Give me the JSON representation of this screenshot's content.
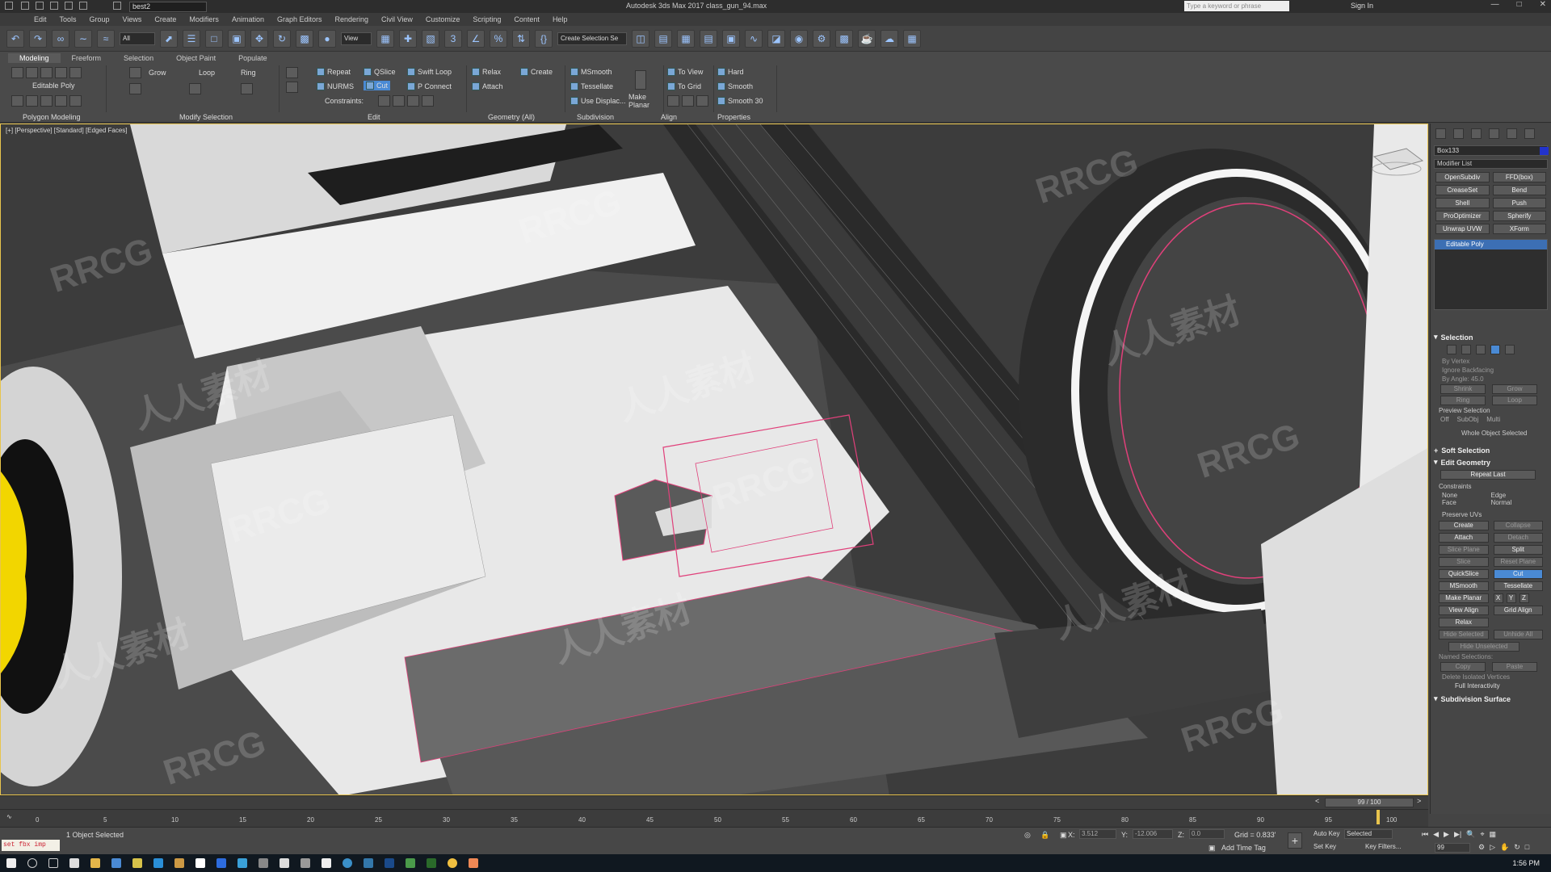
{
  "titlebar": {
    "workspace": "best2",
    "title": "Autodesk 3ds Max 2017     class_gun_94.max",
    "search_placeholder": "Type a keyword or phrase",
    "sign_in": "Sign In"
  },
  "menu": [
    "Edit",
    "Tools",
    "Group",
    "Views",
    "Create",
    "Modifiers",
    "Animation",
    "Graph Editors",
    "Rendering",
    "Civil View",
    "Customize",
    "Scripting",
    "Content",
    "Help"
  ],
  "toolbar": {
    "filter": "All",
    "ref_coord": "View",
    "selection_set": "Create Selection Se"
  },
  "ribbon": {
    "tabs": [
      "Modeling",
      "Freeform",
      "Selection",
      "Object Paint",
      "Populate"
    ],
    "active_tab": "Modeling",
    "polygon_modeling": "Polygon Modeling",
    "editable_poly": "Editable Poly",
    "modify_selection": "Modify Selection",
    "loop": "Loop",
    "ring": "Ring",
    "grow": "Grow",
    "edit_label": "Edit",
    "repeat": "Repeat",
    "qslice": "QSlice",
    "swift_loop": "Swift Loop",
    "nurms": "NURMS",
    "cut": "Cut",
    "p_connect": "P Connect",
    "constraints": "Constraints:",
    "relax": "Relax",
    "create": "Create",
    "attach": "Attach",
    "geometry_all": "Geometry (All)",
    "msmooth": "MSmooth",
    "tessellate": "Tessellate",
    "use_displac": "Use Displac...",
    "subdivision": "Subdivision",
    "make_planar": "Make Planar",
    "to_view": "To View",
    "to_grid": "To Grid",
    "align": "Align",
    "hard": "Hard",
    "smooth": "Smooth",
    "smooth30": "Smooth 30",
    "properties": "Properties"
  },
  "viewport": {
    "label": "[+] [Perspective] [Standard] [Edged Faces]",
    "watermarks": [
      "RRCG",
      "人人素材"
    ]
  },
  "command_panel": {
    "object_name": "Box133",
    "modifier_list": "Modifier List",
    "modifier_buttons": [
      "OpenSubdiv",
      "FFD(box)",
      "CreaseSet",
      "Bend",
      "Shell",
      "Push",
      "ProOptimizer",
      "Spherify",
      "Unwrap UVW",
      "XForm"
    ],
    "stack_item": "Editable Poly",
    "selection_rollout": "Selection",
    "by_vertex": "By Vertex",
    "ignore_backfacing": "Ignore Backfacing",
    "by_angle": "By Angle:",
    "by_angle_value": "45.0",
    "shrink": "Shrink",
    "grow": "Grow",
    "ring": "Ring",
    "loop": "Loop",
    "preview_selection": "Preview Selection",
    "preview_off": "Off",
    "preview_subobj": "SubObj",
    "preview_multi": "Multi",
    "whole_object_selected": "Whole Object Selected",
    "soft_selection": "Soft Selection",
    "edit_geometry": "Edit Geometry",
    "repeat_last": "Repeat Last",
    "constraints": "Constraints",
    "c_none": "None",
    "c_edge": "Edge",
    "c_face": "Face",
    "c_normal": "Normal",
    "preserve_uvs": "Preserve UVs",
    "create": "Create",
    "collapse": "Collapse",
    "attach": "Attach",
    "detach": "Detach",
    "slice_plane": "Slice Plane",
    "split": "Split",
    "slice": "Slice",
    "reset_plane": "Reset Plane",
    "quickslice": "QuickSlice",
    "cut": "Cut",
    "msmooth": "MSmooth",
    "tessellate": "Tessellate",
    "make_planar": "Make Planar",
    "x": "X",
    "y": "Y",
    "z": "Z",
    "view_align": "View Align",
    "grid_align": "Grid Align",
    "relax": "Relax",
    "hide_selected": "Hide Selected",
    "unhide_all": "Unhide All",
    "hide_unselected": "Hide Unselected",
    "named_selections": "Named Selections:",
    "copy": "Copy",
    "paste": "Paste",
    "delete_isolated": "Delete Isolated Vertices",
    "full_interactivity": "Full Interactivity",
    "subdivision_surface": "Subdivision Surface"
  },
  "timeline": {
    "frame": "99 / 100",
    "ticks": [
      "0",
      "5",
      "10",
      "15",
      "20",
      "25",
      "30",
      "35",
      "40",
      "45",
      "50",
      "55",
      "60",
      "65",
      "70",
      "75",
      "80",
      "85",
      "90",
      "95",
      "100"
    ]
  },
  "status": {
    "maxscript": "set fbx imp",
    "objects_selected": "1 Object Selected",
    "x_label": "X:",
    "x_value": "3.512",
    "y_label": "Y:",
    "y_value": "-12.006",
    "z_label": "Z:",
    "z_value": "0.0",
    "grid": "Grid = 0.833'",
    "add_time_tag": "Add Time Tag",
    "auto_key": "Auto Key",
    "selected": "Selected",
    "set_key": "Set Key",
    "key_filters": "Key Filters...",
    "frame_field": "99",
    "clock": "1:56 PM"
  },
  "colors": {
    "accent": "#4a8ad4",
    "viewport_border": "#e8c44d",
    "selection_pink": "#e0407a"
  }
}
